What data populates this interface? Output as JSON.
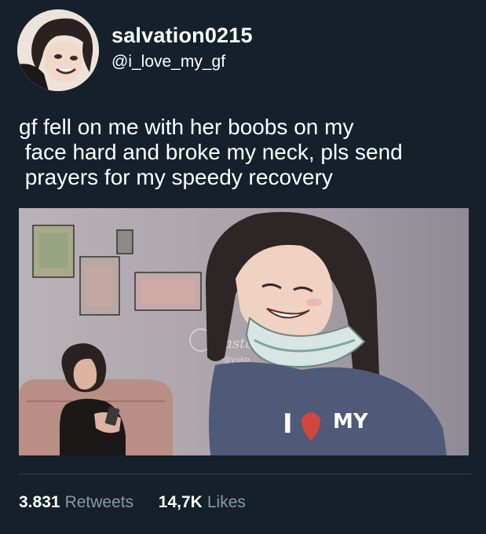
{
  "profile": {
    "display_name": "salvation0215",
    "handle": "@i_love_my_gf"
  },
  "tweet": {
    "text": "gf fell on me with her boobs on my\n face hard and broke my neck, pls send\n prayers for my speedy recovery"
  },
  "media": {
    "shirt_text_line1": "I",
    "shirt_text_line2": "MY",
    "watermark": "Pasta",
    "watermark_handle": "@yuko_"
  },
  "stats": {
    "retweets_count": "3.831",
    "retweets_label": "Retweets",
    "likes_count": "14,7K",
    "likes_label": "Likes"
  },
  "colors": {
    "background": "#15202b",
    "text": "#ffffff",
    "secondary_text": "#8899a6",
    "divider": "#2f3b47"
  }
}
